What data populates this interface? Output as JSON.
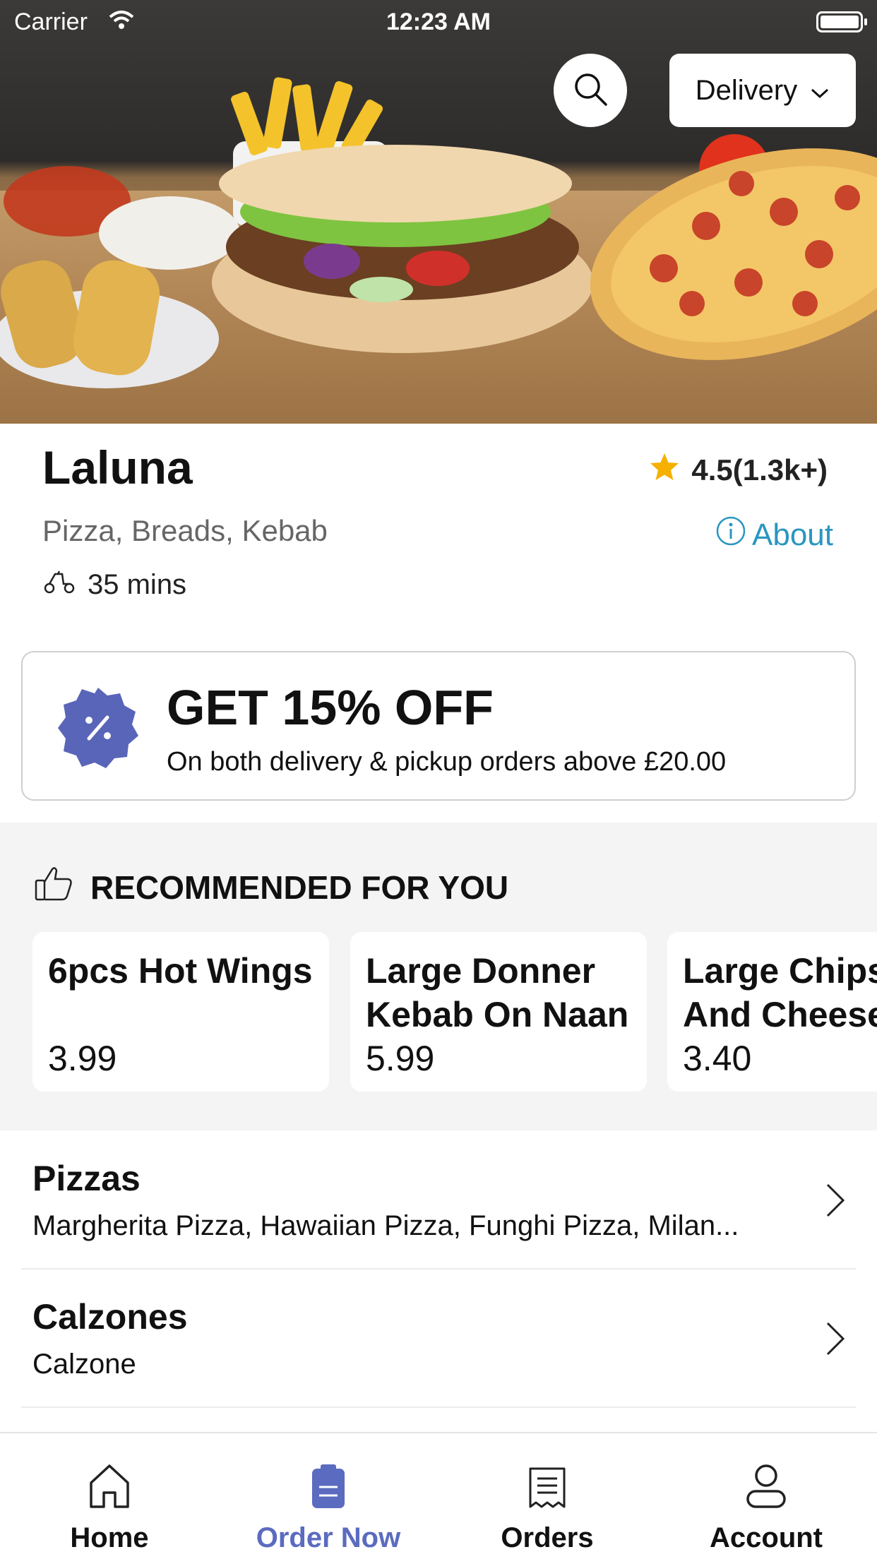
{
  "status_bar": {
    "carrier": "Carrier",
    "time": "12:23 AM"
  },
  "header": {
    "delivery_label": "Delivery"
  },
  "restaurant": {
    "name": "Laluna",
    "cuisines": "Pizza, Breads, Kebab",
    "eta": "35 mins",
    "rating": "4.5(1.3k+)",
    "about_label": "About"
  },
  "offer": {
    "headline": "GET 15% OFF",
    "subtext": "On both delivery & pickup orders above £20.00"
  },
  "recommended": {
    "title": "RECOMMENDED FOR YOU",
    "items": [
      {
        "title": "6pcs Hot Wings",
        "price": "3.99"
      },
      {
        "title": "Large Donner Kebab On Naan",
        "price": "5.99"
      },
      {
        "title": "Large Chips And Cheese",
        "price": "3.40"
      }
    ]
  },
  "categories": [
    {
      "title": "Pizzas",
      "items": "Margherita Pizza, Hawaiian Pizza, Funghi Pizza, Milan..."
    },
    {
      "title": "Calzones",
      "items": "Calzone"
    }
  ],
  "tabs": [
    {
      "label": "Home",
      "icon": "home-icon"
    },
    {
      "label": "Order Now",
      "icon": "order-icon",
      "active": true
    },
    {
      "label": "Orders",
      "icon": "receipt-icon"
    },
    {
      "label": "Account",
      "icon": "person-icon"
    }
  ],
  "colors": {
    "accent": "#5b6bbf",
    "link": "#2a96c0",
    "star": "#f5b000",
    "offer_badge": "#5965b8"
  }
}
